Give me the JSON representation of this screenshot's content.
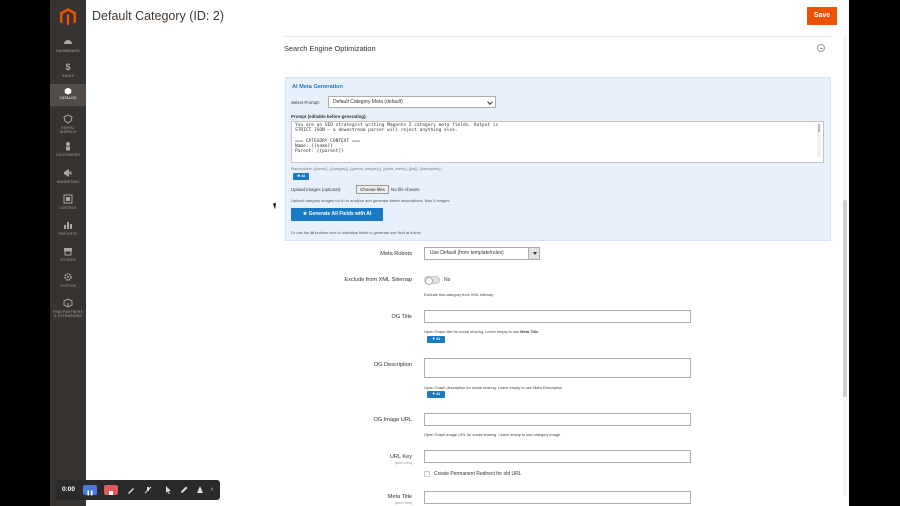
{
  "header": {
    "title": "Default Category (ID: 2)",
    "save_label": "Save"
  },
  "sidebar": {
    "items": [
      {
        "label": "DASHBOARD"
      },
      {
        "label": "SALES"
      },
      {
        "label": "CATALOG"
      },
      {
        "label": "PAYPAL",
        "label2": "INSPECH"
      },
      {
        "label": "CUSTOMERS"
      },
      {
        "label": "MARKETING"
      },
      {
        "label": "CONTENT"
      },
      {
        "label": "REPORTS"
      },
      {
        "label": "STORES"
      },
      {
        "label": "SYSTEM"
      },
      {
        "label": "FIND PARTNERS",
        "label2": "& EXTENSIONS"
      }
    ]
  },
  "section": {
    "title": "Search Engine Optimization"
  },
  "ai": {
    "title": "AI Meta Generation",
    "select_prompt_label": "Select Prompt:",
    "select_prompt_value": "Default Category Meta (default)",
    "prompt_label": "Prompt (editable before generating):",
    "prompt_text": "You are an SEO strategist writing Magento 2 category meta fields. Output is\nSTRICT JSON — a downstream parser will reject anything else.\n\n=== CATEGORY CONTEXT ===\nName: {{name}}\nParent: {{parent}}",
    "placeholders": "Placeholders: {{name}}, {{category}}, {{parent_category}}, {{store_name}}, {{url}}, {{description}}",
    "ai_label": "★ AI",
    "upload_label": "Upload Images (optional):",
    "choose_files": "Choose files",
    "no_file": "No file chosen",
    "upload_hint": "Upload category images for AI to analyze and generate better descriptions. Max 5 images.",
    "generate_all": "★ Generate All Fields with AI",
    "or_use_pre": "Or use the ",
    "or_use_ai": "AI",
    "or_use_post": " buttons next to individual fields to generate one field at a time."
  },
  "fields": {
    "meta_robots": {
      "label": "Meta Robots",
      "value": "Use Default (from template/rules)"
    },
    "exclude_sitemap": {
      "label": "Exclude from XML Sitemap",
      "value": "No",
      "hint": "Exclude this category from XML sitemap"
    },
    "og_title": {
      "label": "OG Title",
      "hint_pre": "Open Graph title for social sharing. Leave empty to use ",
      "hint_b": "Meta Title",
      "hint_post": ".",
      "ai_label": "✦ AI"
    },
    "og_description": {
      "label": "OG Description",
      "hint": "Open Graph description for social sharing. Leave empty to use Meta Description.",
      "ai_label": "✦ AI"
    },
    "og_image_url": {
      "label": "OG Image URL",
      "hint": "Open Graph image URL for social sharing. Leave empty to use category image."
    },
    "url_key": {
      "label": "URL Key",
      "scope": "[store view]",
      "redirect_label": "Create Permanent Redirect for old URL"
    },
    "meta_title": {
      "label": "Meta Title",
      "scope": "[store view]"
    }
  },
  "recorder": {
    "time": "0:00"
  }
}
